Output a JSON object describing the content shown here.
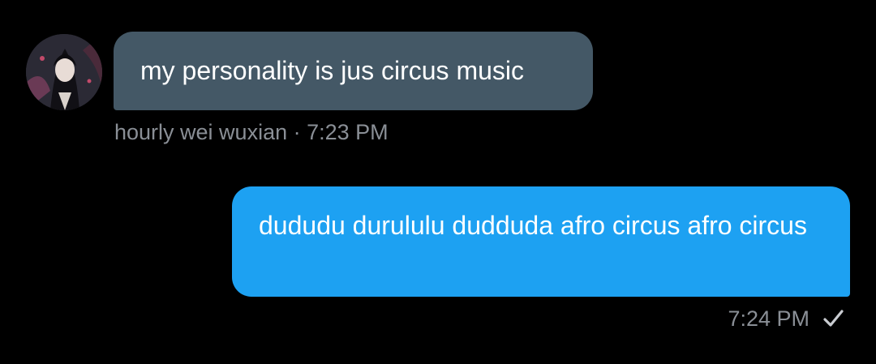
{
  "incoming": {
    "message": "my personality is jus circus music",
    "sender": "hourly wei wuxian",
    "separator": " · ",
    "time": "7:23 PM"
  },
  "outgoing": {
    "message": "dududu durululu dudduda afro circus afro circus",
    "time": "7:24 PM",
    "status_icon": "checkmark-icon"
  },
  "colors": {
    "background": "#000000",
    "incoming_bubble": "#445866",
    "outgoing_bubble": "#1da1f2",
    "meta_text": "#8a8f96"
  }
}
